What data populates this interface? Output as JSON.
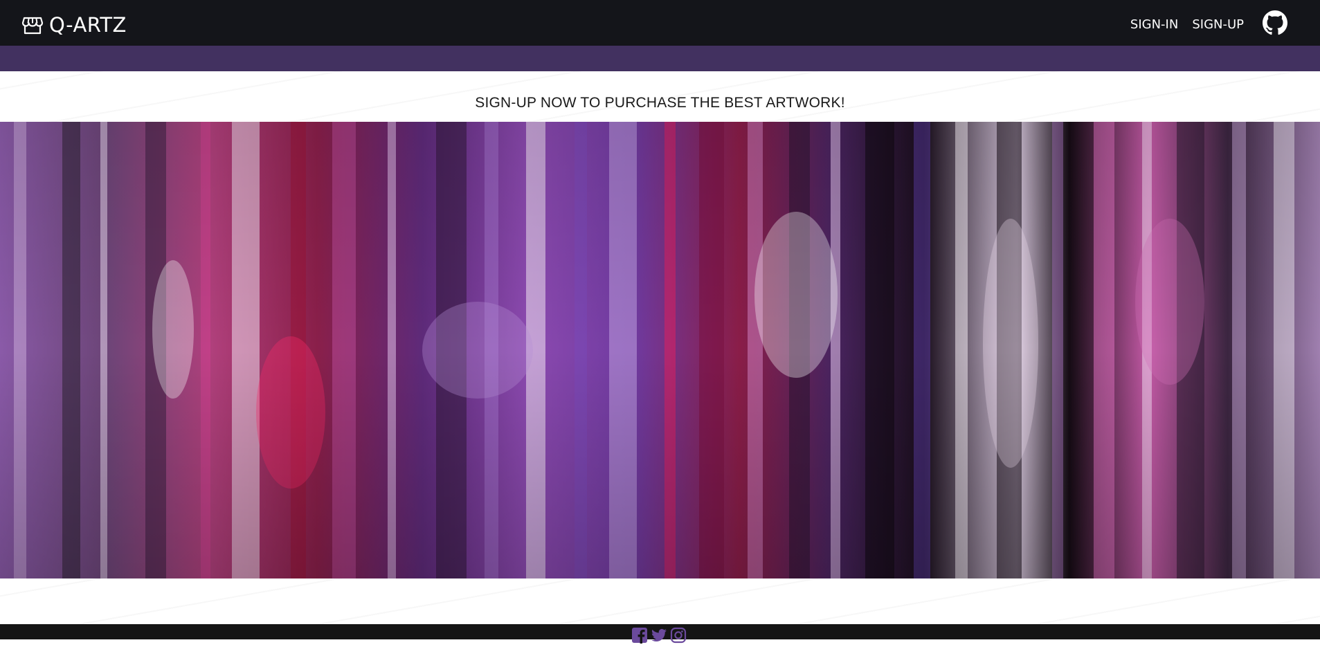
{
  "navbar": {
    "brand": "Q-ARTZ",
    "links": [
      "SIGN-IN",
      "SIGN-UP"
    ]
  },
  "hero": {
    "cta": "SIGN-UP NOW TO PURCHASE THE BEST ARTWORK!"
  },
  "icons": {
    "brand": "store-icon",
    "github": "github-icon",
    "social": [
      "facebook-icon",
      "twitter-icon",
      "instagram-icon"
    ]
  },
  "colors": {
    "navbar": "#14151a",
    "accent": "#423160",
    "footer": "#151515",
    "social": "#6b4a9c"
  }
}
